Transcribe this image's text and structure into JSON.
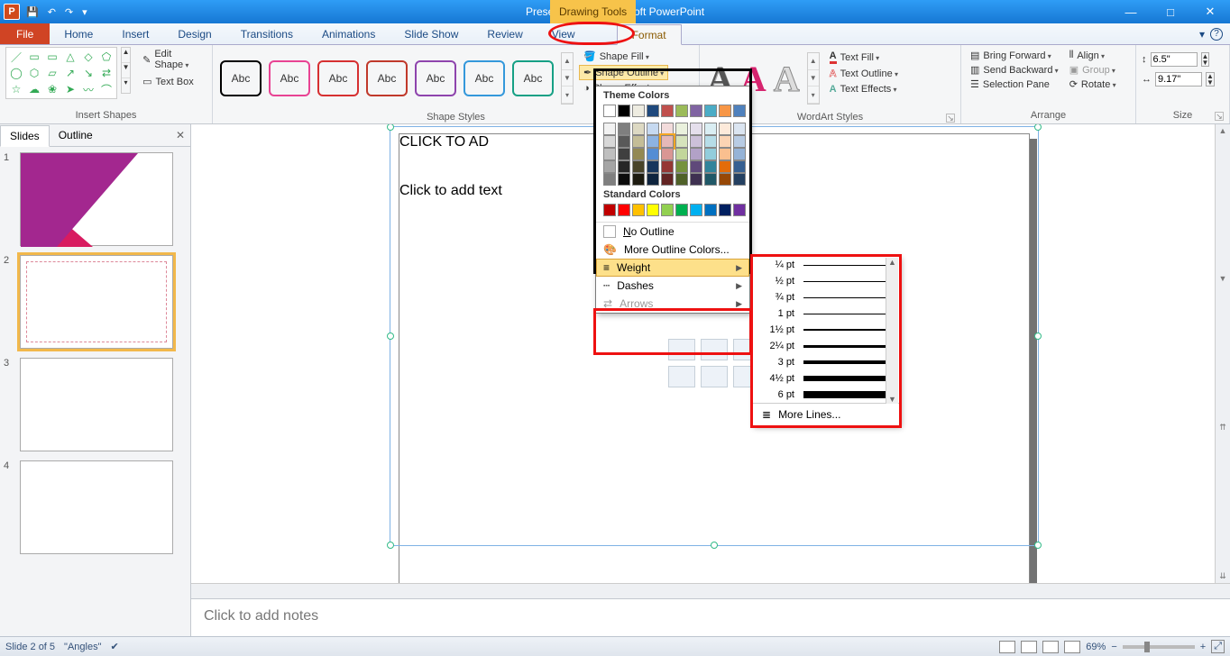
{
  "title": "Presentation1 - Microsoft PowerPoint",
  "context_tab": "Drawing Tools",
  "win": {
    "min": "—",
    "max": "□",
    "close": "✕",
    "restore_ribbon": "▾",
    "help": "?"
  },
  "tabs": {
    "file": "File",
    "home": "Home",
    "insert": "Insert",
    "design": "Design",
    "transitions": "Transitions",
    "animations": "Animations",
    "slideshow": "Slide Show",
    "review": "Review",
    "view": "View",
    "format": "Format"
  },
  "ribbon": {
    "insert_shapes": {
      "label": "Insert Shapes",
      "edit_shape": "Edit Shape",
      "text_box": "Text Box"
    },
    "shape_styles": {
      "label": "Shape Styles",
      "sample": "Abc",
      "fill": "Shape Fill",
      "outline": "Shape Outline",
      "effects": "Shape Effects"
    },
    "wordart": {
      "label": "WordArt Styles",
      "text_fill": "Text Fill",
      "text_outline": "Text Outline",
      "text_effects": "Text Effects"
    },
    "arrange": {
      "label": "Arrange",
      "bring_forward": "Bring Forward",
      "send_backward": "Send Backward",
      "selection_pane": "Selection Pane",
      "align": "Align",
      "group": "Group",
      "rotate": "Rotate"
    },
    "size": {
      "label": "Size",
      "height": "6.5\"",
      "width": "9.17\""
    }
  },
  "outline_popup": {
    "theme_hdr": "Theme Colors",
    "standard_hdr": "Standard Colors",
    "no_outline": "No Outline",
    "more_colors": "More Outline Colors...",
    "weight": "Weight",
    "dashes": "Dashes",
    "arrows": "Arrows",
    "theme_colors_row1": [
      "#ffffff",
      "#000000",
      "#eeece1",
      "#1f497d",
      "#c0504d",
      "#9bbb59",
      "#8064a2",
      "#4bacc6",
      "#f79646",
      "#4f81bd"
    ],
    "theme_shades": [
      [
        "#f2f2f2",
        "#7f7f7f",
        "#ddd9c3",
        "#c6d9f0",
        "#f2dbdb",
        "#eaf1dd",
        "#e5dfec",
        "#daeef3",
        "#fdeada",
        "#dbe5f1"
      ],
      [
        "#d8d8d8",
        "#595959",
        "#c4bd97",
        "#8db3e2",
        "#e5b8b7",
        "#d6e3bc",
        "#ccc0d9",
        "#b6dde8",
        "#fbd4b4",
        "#b8cce4"
      ],
      [
        "#bfbfbf",
        "#3f3f3f",
        "#938953",
        "#548dd4",
        "#d99694",
        "#c2d69b",
        "#b2a1c7",
        "#92cddc",
        "#fabf8f",
        "#95b3d7"
      ],
      [
        "#a5a5a5",
        "#262626",
        "#494429",
        "#17365d",
        "#953734",
        "#76923c",
        "#5f497a",
        "#31849b",
        "#e36c09",
        "#366092"
      ],
      [
        "#7f7f7f",
        "#0c0c0c",
        "#1d1b10",
        "#0f243e",
        "#632423",
        "#4f6128",
        "#3f3151",
        "#205867",
        "#974806",
        "#244061"
      ]
    ],
    "standard_colors": [
      "#c00000",
      "#ff0000",
      "#ffc000",
      "#ffff00",
      "#92d050",
      "#00b050",
      "#00b0f0",
      "#0070c0",
      "#002060",
      "#7030a0"
    ]
  },
  "weight_popup": {
    "items": [
      {
        "label": "¼ pt",
        "w": 0.5
      },
      {
        "label": "½ pt",
        "w": 1
      },
      {
        "label": "¾ pt",
        "w": 1
      },
      {
        "label": "1 pt",
        "w": 1.5
      },
      {
        "label": "1½ pt",
        "w": 2
      },
      {
        "label": "2¼ pt",
        "w": 3
      },
      {
        "label": "3 pt",
        "w": 4
      },
      {
        "label": "4½ pt",
        "w": 6
      },
      {
        "label": "6 pt",
        "w": 8
      }
    ],
    "more": "More Lines..."
  },
  "panel": {
    "slides": "Slides",
    "outline": "Outline"
  },
  "slide": {
    "title_ph": "CLICK TO AD",
    "body_ph": "Click to add text"
  },
  "notes": "Click to add notes",
  "status": {
    "slide": "Slide 2 of 5",
    "theme": "\"Angles\"",
    "zoom": "69%",
    "fitlabel": "⤢"
  }
}
